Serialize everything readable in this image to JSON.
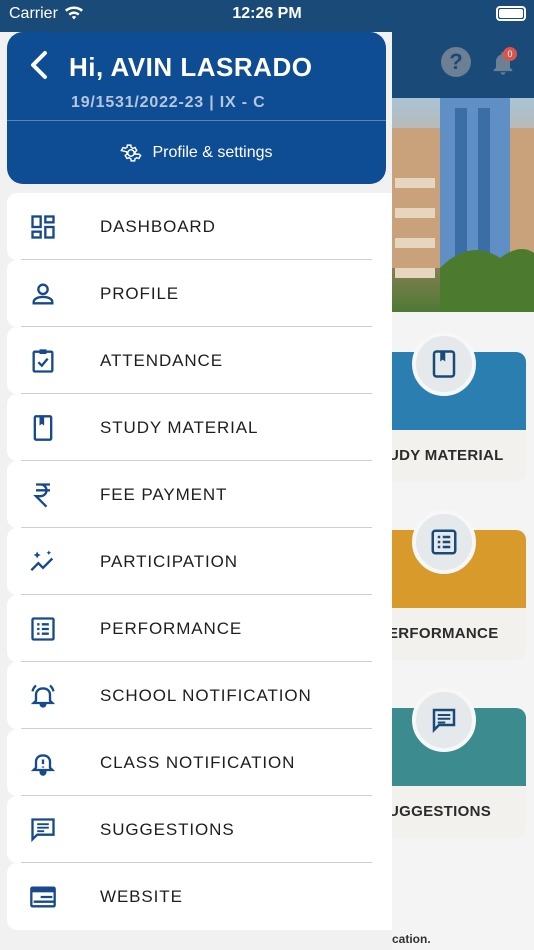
{
  "status_bar": {
    "carrier": "Carrier",
    "time": "12:26 PM"
  },
  "background": {
    "notification_count": "0",
    "cards": [
      {
        "label": "UDY MATERIAL",
        "color": "#2a7fb0"
      },
      {
        "label": "ERFORMANCE",
        "color": "#d89a2b"
      },
      {
        "label": "UGGESTIONS",
        "color": "#3b8b8f"
      }
    ],
    "footer_text": "cation."
  },
  "drawer": {
    "greeting": "Hi, AVIN LASRADO",
    "student_info": "19/1531/2022-23  |  IX - C",
    "settings_label": "Profile & settings",
    "items": [
      {
        "label": "DASHBOARD",
        "icon": "dashboard-icon"
      },
      {
        "label": "PROFILE",
        "icon": "person-icon"
      },
      {
        "label": "ATTENDANCE",
        "icon": "clipboard-check-icon"
      },
      {
        "label": "STUDY MATERIAL",
        "icon": "book-bookmark-icon"
      },
      {
        "label": "FEE PAYMENT",
        "icon": "rupee-icon"
      },
      {
        "label": "PARTICIPATION",
        "icon": "sparkle-chart-icon"
      },
      {
        "label": "PERFORMANCE",
        "icon": "list-document-icon"
      },
      {
        "label": "SCHOOL NOTIFICATION",
        "icon": "alarm-bell-icon"
      },
      {
        "label": "CLASS NOTIFICATION",
        "icon": "bell-alert-icon"
      },
      {
        "label": "SUGGESTIONS",
        "icon": "message-icon"
      },
      {
        "label": "WEBSITE",
        "icon": "browser-window-icon"
      }
    ]
  },
  "colors": {
    "primary": "#0e4c93",
    "header": "#1a4a78",
    "icon": "#174a8c"
  }
}
